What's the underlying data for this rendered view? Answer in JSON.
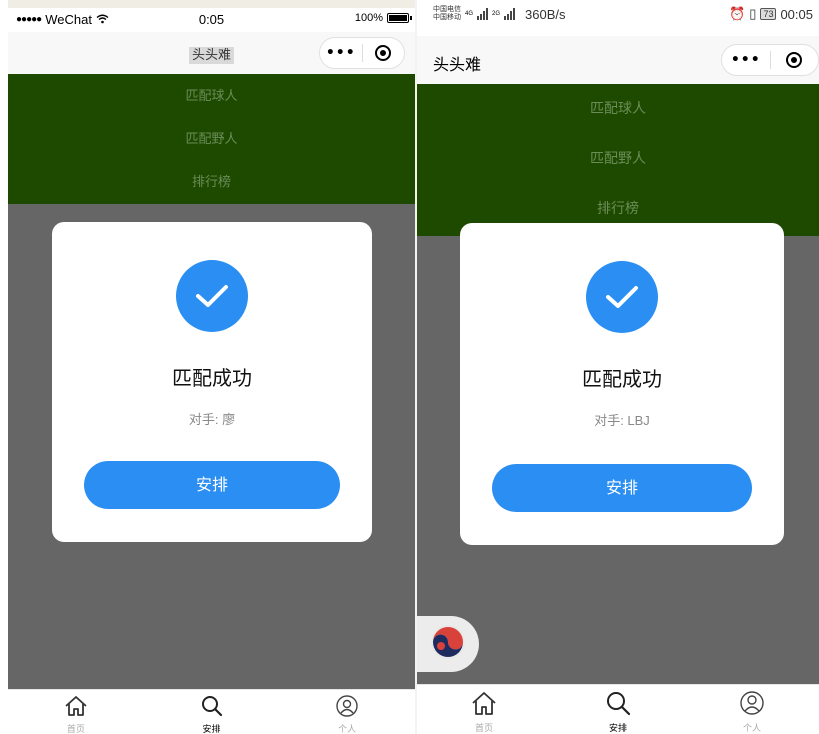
{
  "left_phone": {
    "status_bar": {
      "carrier": "WeChat",
      "time": "0:05",
      "battery": "100%"
    },
    "nav": {
      "title": "头头难",
      "more_label": "•••"
    },
    "menu": [
      "匹配球人",
      "匹配野人",
      "排行榜"
    ],
    "modal": {
      "title": "匹配成功",
      "subtitle": "对手: 廖",
      "button": "安排"
    },
    "tabs": [
      {
        "label": "首页",
        "icon": "home-icon"
      },
      {
        "label": "安排",
        "icon": "search-icon",
        "active": true
      },
      {
        "label": "个人",
        "icon": "user-icon"
      }
    ]
  },
  "right_phone": {
    "status_bar": {
      "carrier1": "中国电信",
      "carrier2": "中国移动",
      "net1": "4G",
      "net2": "2G",
      "speed": "360B/s",
      "battery": "73",
      "time": "00:05"
    },
    "nav": {
      "title": "头头难",
      "more_label": "•••"
    },
    "menu": [
      "匹配球人",
      "匹配野人",
      "排行榜"
    ],
    "modal": {
      "title": "匹配成功",
      "subtitle": "对手: LBJ",
      "button": "安排"
    },
    "tabs": [
      {
        "label": "首页",
        "icon": "home-icon"
      },
      {
        "label": "安排",
        "icon": "search-icon",
        "active": true
      },
      {
        "label": "个人",
        "icon": "user-icon"
      }
    ]
  },
  "colors": {
    "accent_blue": "#2b8ef2",
    "menu_green": "#1e4a00",
    "overlay_gray": "#666666"
  }
}
